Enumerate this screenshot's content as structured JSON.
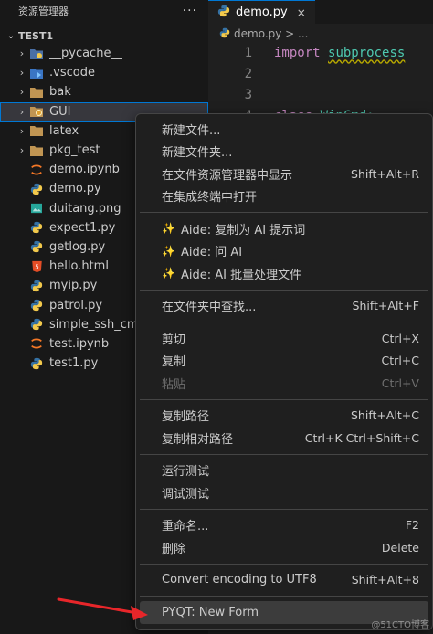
{
  "sidebar": {
    "title": "资源管理器",
    "more_label": "···",
    "section": "TEST1",
    "items": [
      {
        "label": "__pycache__",
        "kind": "folder-py",
        "expandable": true
      },
      {
        "label": ".vscode",
        "kind": "folder-vscode",
        "expandable": true
      },
      {
        "label": "bak",
        "kind": "folder",
        "expandable": true
      },
      {
        "label": "GUI",
        "kind": "folder-gui",
        "expandable": true,
        "selected": true
      },
      {
        "label": "latex",
        "kind": "folder",
        "expandable": true
      },
      {
        "label": "pkg_test",
        "kind": "folder",
        "expandable": true
      },
      {
        "label": "demo.ipynb",
        "kind": "jupyter",
        "expandable": false
      },
      {
        "label": "demo.py",
        "kind": "python",
        "expandable": false
      },
      {
        "label": "duitang.png",
        "kind": "image",
        "expandable": false
      },
      {
        "label": "expect1.py",
        "kind": "python",
        "expandable": false
      },
      {
        "label": "getlog.py",
        "kind": "python",
        "expandable": false
      },
      {
        "label": "hello.html",
        "kind": "html",
        "expandable": false
      },
      {
        "label": "myip.py",
        "kind": "python",
        "expandable": false
      },
      {
        "label": "patrol.py",
        "kind": "python",
        "expandable": false
      },
      {
        "label": "simple_ssh_cmd.py",
        "kind": "python",
        "expandable": false
      },
      {
        "label": "test.ipynb",
        "kind": "jupyter",
        "expandable": false
      },
      {
        "label": "test1.py",
        "kind": "python",
        "expandable": false
      }
    ]
  },
  "editor": {
    "tab_label": "demo.py",
    "tab_close": "×",
    "breadcrumb": "demo.py > ...",
    "lines": [
      {
        "num": "1",
        "kw": "import",
        "text": "subprocess"
      },
      {
        "num": "2",
        "kw": "",
        "text": ""
      },
      {
        "num": "3",
        "kw": "",
        "text": ""
      },
      {
        "num": "4",
        "kw": "class",
        "text": "WinCmd:"
      }
    ]
  },
  "menu": {
    "groups": [
      [
        {
          "label": "新建文件...",
          "shortcut": ""
        },
        {
          "label": "新建文件夹...",
          "shortcut": ""
        },
        {
          "label": "在文件资源管理器中显示",
          "shortcut": "Shift+Alt+R"
        },
        {
          "label": "在集成终端中打开",
          "shortcut": ""
        }
      ],
      [
        {
          "label": "Aide: 复制为 AI 提示词",
          "shortcut": "",
          "spark": true
        },
        {
          "label": "Aide: 问 AI",
          "shortcut": "",
          "spark": true
        },
        {
          "label": "Aide: AI 批量处理文件",
          "shortcut": "",
          "spark": true
        }
      ],
      [
        {
          "label": "在文件夹中查找...",
          "shortcut": "Shift+Alt+F"
        }
      ],
      [
        {
          "label": "剪切",
          "shortcut": "Ctrl+X"
        },
        {
          "label": "复制",
          "shortcut": "Ctrl+C"
        },
        {
          "label": "粘贴",
          "shortcut": "Ctrl+V",
          "disabled": true
        }
      ],
      [
        {
          "label": "复制路径",
          "shortcut": "Shift+Alt+C"
        },
        {
          "label": "复制相对路径",
          "shortcut": "Ctrl+K Ctrl+Shift+C"
        }
      ],
      [
        {
          "label": "运行测试",
          "shortcut": ""
        },
        {
          "label": "调试测试",
          "shortcut": ""
        }
      ],
      [
        {
          "label": "重命名...",
          "shortcut": "F2"
        },
        {
          "label": "删除",
          "shortcut": "Delete"
        }
      ],
      [
        {
          "label": "Convert encoding to UTF8",
          "shortcut": "Shift+Alt+8"
        }
      ],
      [
        {
          "label": "PYQT: New Form",
          "shortcut": "",
          "highlight": true
        }
      ]
    ]
  },
  "colors": {
    "accent": "#0078d4",
    "python_blue": "#3572A5",
    "python_yellow": "#f2c94c",
    "folder": "#c09553",
    "jupyter": "#f37726",
    "html": "#e44d26",
    "arrow": "#e8262a"
  },
  "watermark": "@51CTO博客"
}
